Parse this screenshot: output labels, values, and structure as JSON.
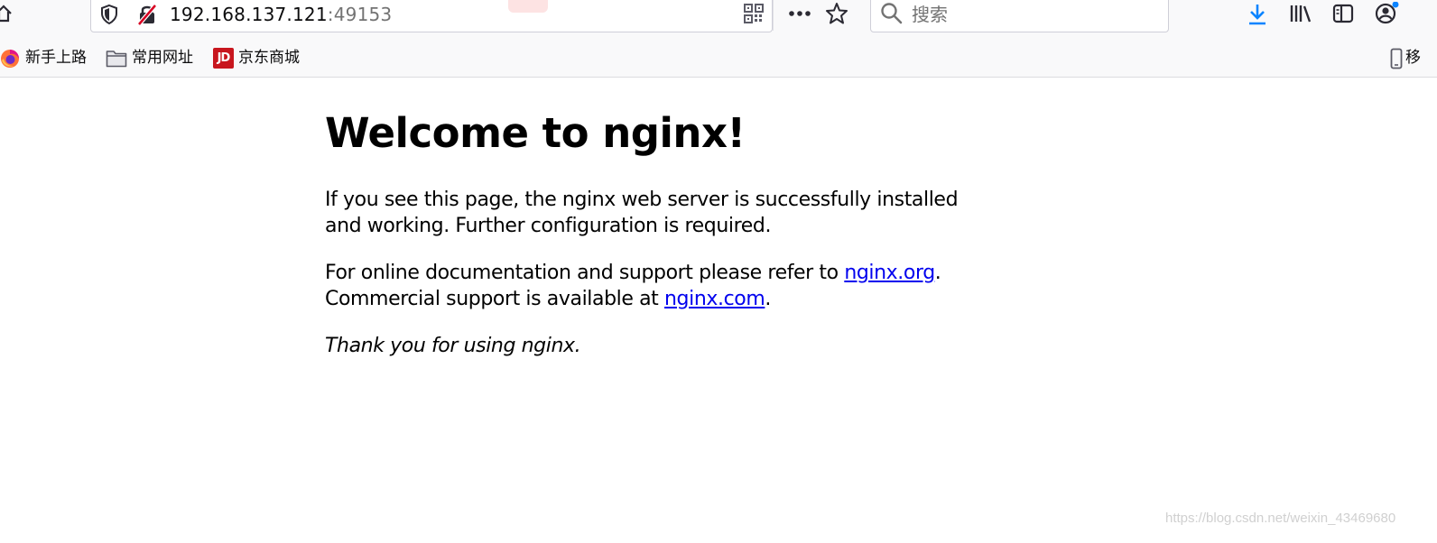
{
  "browser": {
    "url_host": "192.168.137.121",
    "url_port": ":49153",
    "search_placeholder": "搜索",
    "icons": {
      "home": "home-icon",
      "tracking": "shield-icon",
      "insecure": "insecure-lock-icon",
      "qr": "qr-code-icon",
      "more": "more-dots-icon",
      "bookmark": "star-icon",
      "search": "search-icon",
      "download": "download-icon",
      "library": "library-icon",
      "sidebar": "sidebar-icon",
      "account": "account-icon"
    },
    "colors": {
      "download": "#0a84ff",
      "notify_dot": "#0a84ff",
      "insecure": "#d70022"
    }
  },
  "bookmarks": [
    {
      "label": "新手上路",
      "icon": "firefox-icon"
    },
    {
      "label": "常用网址",
      "icon": "folder-icon"
    },
    {
      "label": "京东商城",
      "icon": "jd-icon",
      "badge": "JD"
    }
  ],
  "bookmarks_overflow": {
    "label": "移",
    "icon": "mobile-icon"
  },
  "page": {
    "title": "Welcome to nginx!",
    "para1": "If you see this page, the nginx web server is successfully installed and working. Further configuration is required.",
    "para2_prefix": "For online documentation and support please refer to ",
    "para2_link": "nginx.org",
    "para2_mid": ".",
    "para2_line2_prefix": "Commercial support is available at ",
    "para2_link2": "nginx.com",
    "para2_suffix": ".",
    "para3": "Thank you for using nginx.",
    "link_color": "#0000ee"
  },
  "watermark": "https://blog.csdn.net/weixin_43469680"
}
